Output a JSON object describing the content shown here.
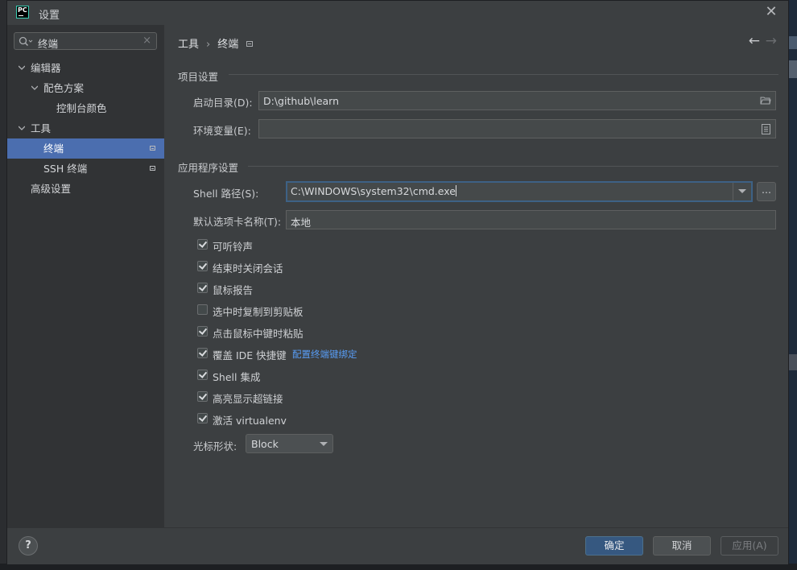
{
  "window": {
    "title": "设置",
    "close": "✕"
  },
  "sidebar": {
    "search_value": "终端",
    "search_clear": "×",
    "items": [
      {
        "label": "编辑器",
        "expanded": true
      },
      {
        "label": "配色方案",
        "expanded": true
      },
      {
        "label": "控制台颜色"
      },
      {
        "label": "工具",
        "expanded": true
      },
      {
        "label": "终端",
        "selected": true
      },
      {
        "label": "SSH 终端"
      },
      {
        "label": "高级设置"
      }
    ]
  },
  "breadcrumb": {
    "parent": "工具",
    "separator": "›",
    "current": "终端"
  },
  "nav": {
    "back": "←",
    "forward": "→"
  },
  "project": {
    "section": "项目设置",
    "start_dir_label": "启动目录(D):",
    "start_dir_value": "D:\\github\\learn",
    "env_label": "环境变量(E):",
    "env_value": ""
  },
  "app": {
    "section": "应用程序设置",
    "shell_label": "Shell 路径(S):",
    "shell_value": "C:\\WINDOWS\\system32\\cmd.exe",
    "browse": "...",
    "tab_name_label": "默认选项卡名称(T):",
    "tab_name_value": "本地",
    "checkboxes": [
      {
        "label": "可听铃声",
        "checked": true
      },
      {
        "label": "结束时关闭会话",
        "checked": true
      },
      {
        "label": "鼠标报告",
        "checked": true
      },
      {
        "label": "选中时复制到剪贴板",
        "checked": false
      },
      {
        "label": "点击鼠标中键时粘贴",
        "checked": true
      },
      {
        "label": "覆盖 IDE 快捷键",
        "checked": true
      },
      {
        "label": "Shell 集成",
        "checked": true
      },
      {
        "label": "高亮显示超链接",
        "checked": true
      },
      {
        "label": "激活 virtualenv",
        "checked": true
      }
    ],
    "keymap_link": "配置终端键绑定",
    "cursor_label": "光标形状:",
    "cursor_value": "Block"
  },
  "footer": {
    "help": "?",
    "ok": "确定",
    "cancel": "取消",
    "apply": "应用(A)"
  },
  "colors": {
    "selection": "#4b6eaf",
    "primary": "#365880",
    "link": "#589df6",
    "focus": "#3d6185"
  }
}
